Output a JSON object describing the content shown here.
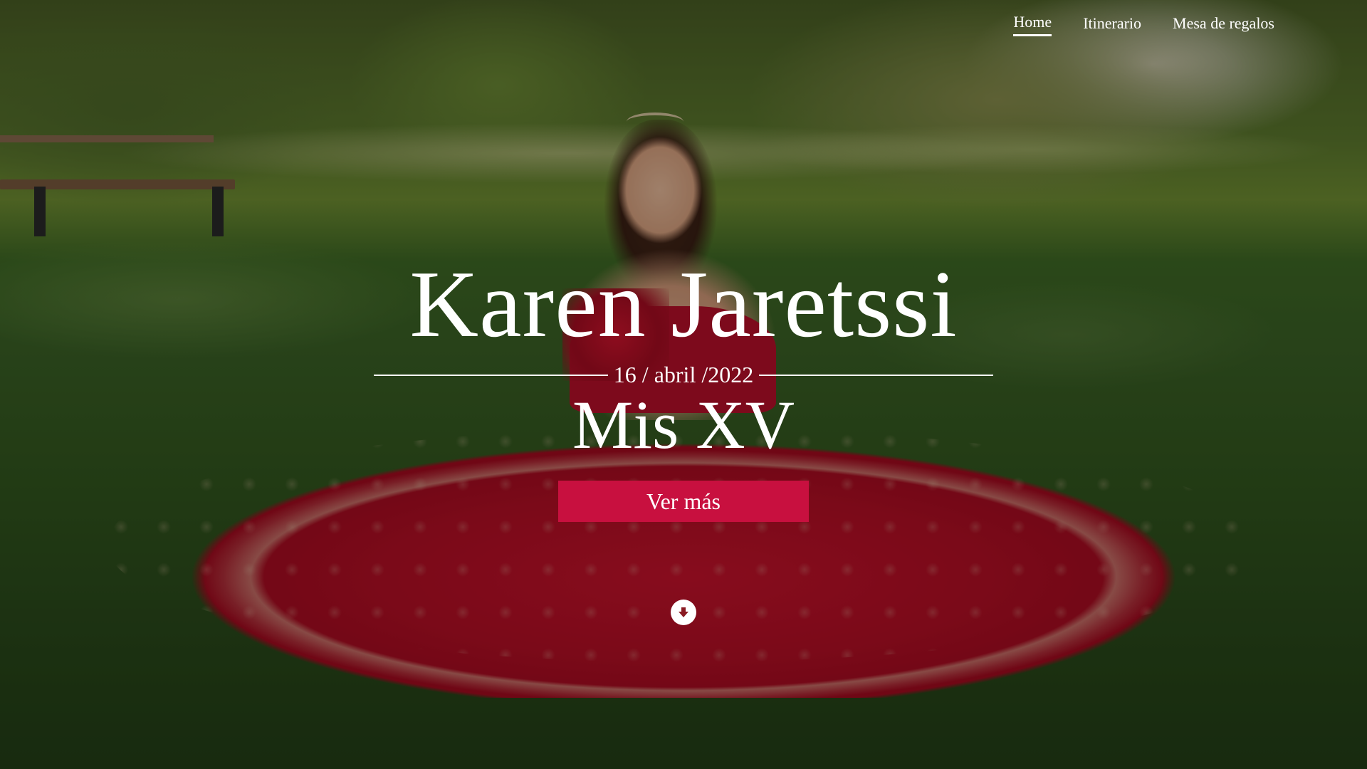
{
  "nav": {
    "items": [
      {
        "label": "Home",
        "active": true
      },
      {
        "label": "Itinerario",
        "active": false
      },
      {
        "label": "Mesa de regalos",
        "active": false
      }
    ]
  },
  "hero": {
    "name": "Karen Jaretssi",
    "date": "16 / abril /2022",
    "subtitle": "Mis XV",
    "cta_label": "Ver más",
    "scroll_icon": "arrow-down-circle-icon"
  },
  "colors": {
    "accent": "#c8103f",
    "text": "#ffffff",
    "dress": "#c8132c"
  }
}
